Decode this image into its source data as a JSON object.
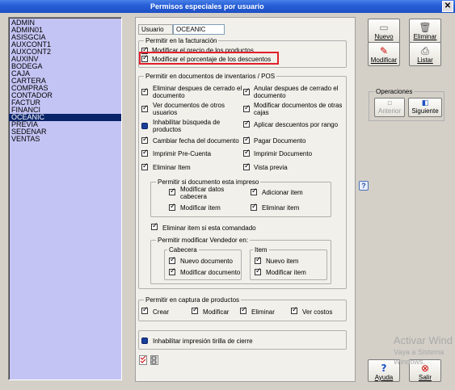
{
  "window": {
    "title": "Permisos especiales por usuario",
    "close_glyph": "✕"
  },
  "users": [
    "ADMIN",
    "ADMIN01",
    "ASISGCIA",
    "AUXCONT1",
    "AUXCONT2",
    "AUXINV",
    "BODEGA",
    "CAJA",
    "CARTERA",
    "COMPRAS",
    "CONTADOR",
    "FACTUR",
    "FINANCI",
    "OCEANIC",
    "PREVIA",
    "SEDENAR",
    "VENTAS"
  ],
  "selected_user": "OCEANIC",
  "usuario": {
    "label": "Usuario",
    "value": "OCEANIC"
  },
  "facturacion": {
    "title": "Permitir en la facturación",
    "items": [
      {
        "label": "Modificar el precio de los productos",
        "checked": true
      },
      {
        "label": "Modificar el porcentaje de los descuentos",
        "checked": true
      }
    ]
  },
  "inventarios": {
    "title": "Permitir en documentos de inventarios / POS",
    "left": [
      {
        "label": "Eliminar despues de cerrado el\ndocumento",
        "checked": true
      },
      {
        "label": "Ver documentos de otros\nusuarios",
        "checked": true
      },
      {
        "label": "Inhabilitar búsqueda de\nproductos",
        "checked": false,
        "style": "filled"
      },
      {
        "label": "Cambiar fecha del documento",
        "checked": true
      },
      {
        "label": "Imprimir Pre-Cuenta",
        "checked": true
      },
      {
        "label": "Eliminar Item",
        "checked": true
      }
    ],
    "right": [
      {
        "label": "Anular despues de cerrado el\ndocumento",
        "checked": true
      },
      {
        "label": "Modificar documentos de otras\ncajas",
        "checked": true
      },
      {
        "label": "Aplicar descuentos por rango",
        "checked": true
      },
      {
        "label": "Pagar Documento",
        "checked": true
      },
      {
        "label": "Imprimir Documento",
        "checked": true
      },
      {
        "label": "Vista previa",
        "checked": true
      }
    ],
    "impreso": {
      "title": "Permitir si documento esta impreso",
      "items": [
        {
          "label": "Modificar datos\ncabecera",
          "checked": true
        },
        {
          "label": "Adicionar item",
          "checked": true
        },
        {
          "label": "Modificar item",
          "checked": true
        },
        {
          "label": "Eliminar item",
          "checked": true
        }
      ]
    },
    "comandado": {
      "label": "Eliminar item si esta comandado",
      "checked": true
    },
    "vendedor": {
      "title": "Permitir modificar Vendedor en:",
      "cabecera": {
        "title": "Cabecera",
        "items": [
          {
            "label": "Nuevo documento",
            "checked": true
          },
          {
            "label": "Modificar documento",
            "checked": true
          }
        ]
      },
      "item": {
        "title": "Item",
        "items": [
          {
            "label": "Nuevo item",
            "checked": true
          },
          {
            "label": "Modificar item",
            "checked": true
          }
        ]
      }
    }
  },
  "captura": {
    "title": "Permitir en captura de productos",
    "items": [
      {
        "label": "Crear",
        "checked": true
      },
      {
        "label": "Modificar",
        "checked": true
      },
      {
        "label": "Eliminar",
        "checked": true
      },
      {
        "label": "Ver costos",
        "checked": true
      }
    ]
  },
  "tirilla": {
    "label": "Inhabilitar impresión tirilla de cierre",
    "checked": false,
    "style": "filled"
  },
  "buttons": {
    "nuevo": "Nuevo",
    "eliminar": "Eliminar",
    "modificar": "Modificar",
    "listar": "Listar",
    "anterior": "Anterior",
    "siguiente": "Siguiente",
    "ayuda": "Ayuda",
    "salir": "Salir"
  },
  "operaciones": {
    "title": "Operaciones"
  },
  "watermark": {
    "line1": "Activar Wind",
    "line2": "Vaya a Sistema",
    "line3": "Windows."
  },
  "help_glyph": "?"
}
